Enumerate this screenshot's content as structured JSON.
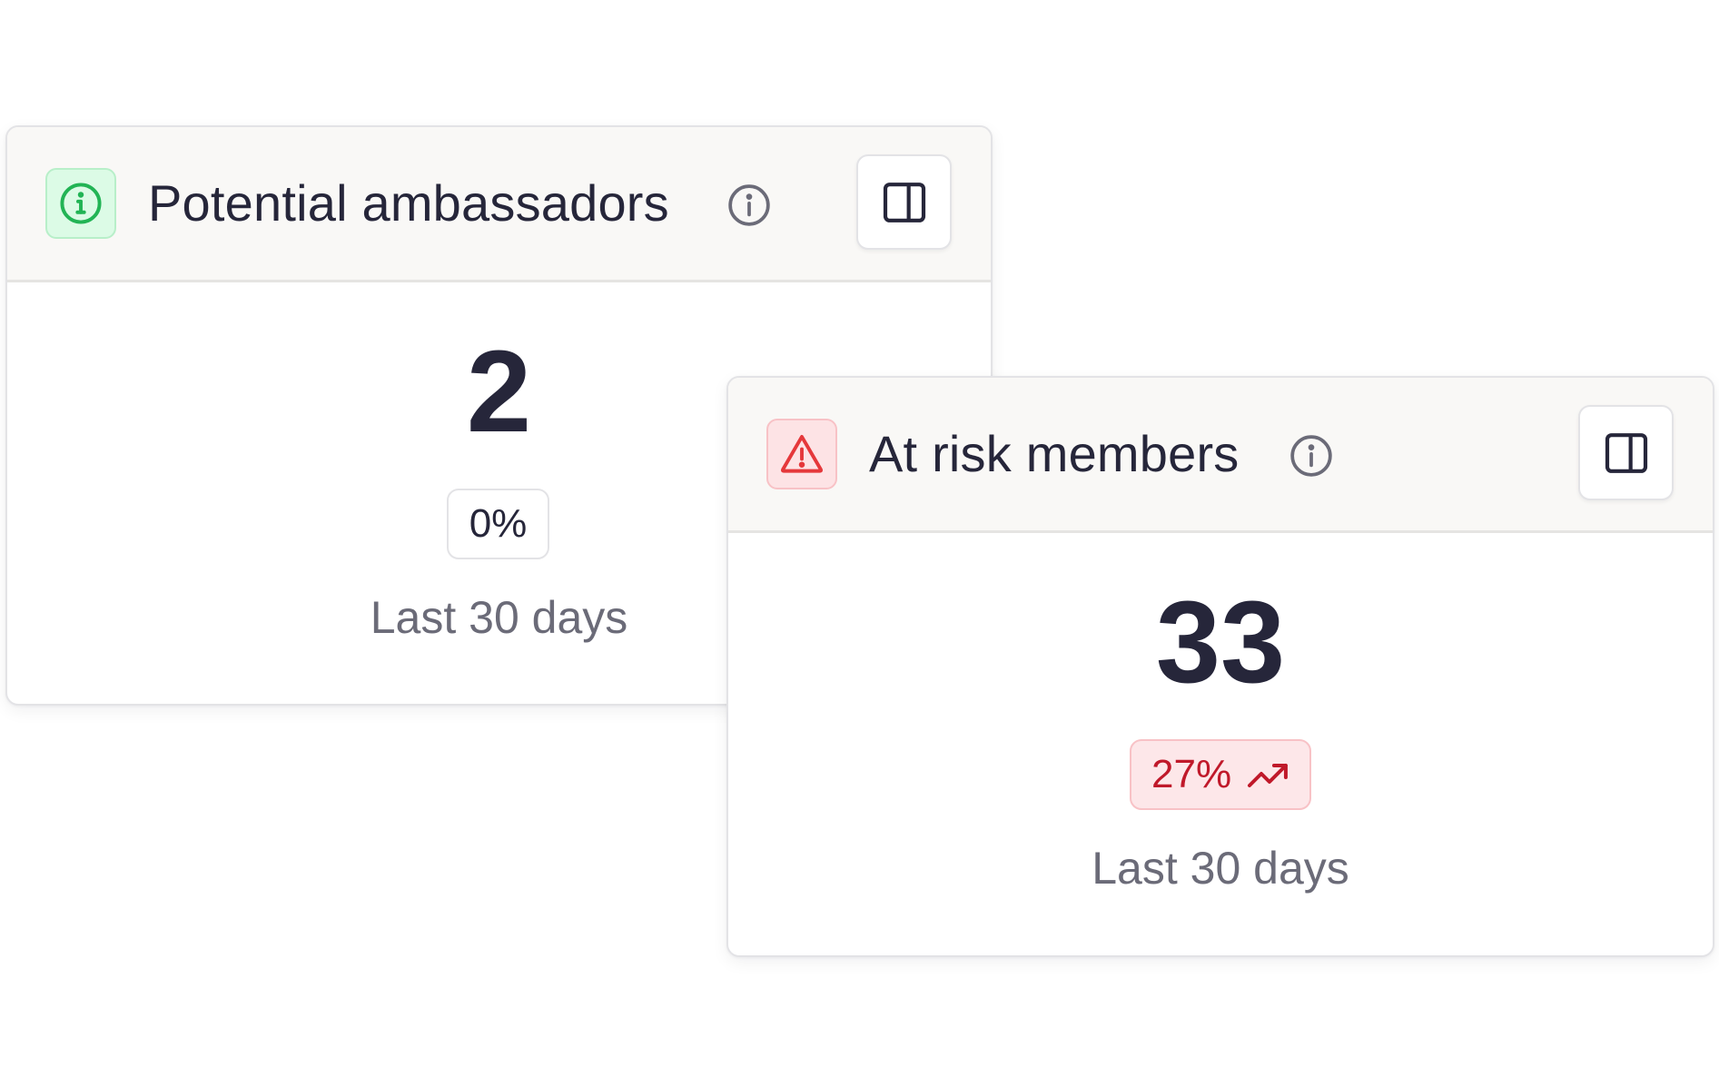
{
  "colors": {
    "positive_accent": "#22b455",
    "positive_bg": "#dcfbe6",
    "danger_accent": "#e5383b",
    "danger_bg": "#fde3e5",
    "trend_up_bad_text": "#c0192a"
  },
  "cards": [
    {
      "title": "Potential ambassadors",
      "status_icon": "info-circle-icon",
      "value": "2",
      "change": "0%",
      "change_trend": "neutral",
      "period": "Last 30 days",
      "action_icon": "sidebar-panel-icon"
    },
    {
      "title": "At risk members",
      "status_icon": "warning-triangle-icon",
      "value": "33",
      "change": "27%",
      "change_trend": "up",
      "change_trend_icon": "trending-up-icon",
      "period": "Last 30 days",
      "action_icon": "sidebar-panel-icon"
    }
  ]
}
